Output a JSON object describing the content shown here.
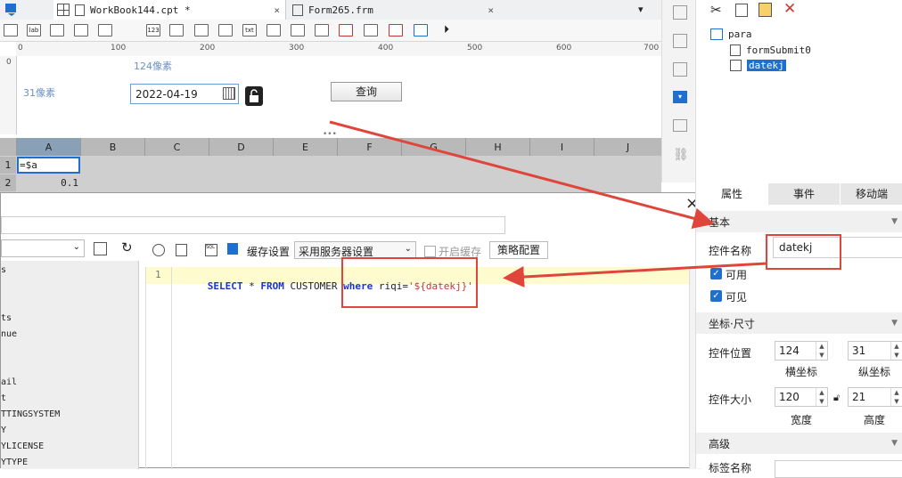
{
  "tabs": [
    {
      "label": "WorkBook144.cpt *",
      "close": "×"
    },
    {
      "label": "Form265.frm",
      "close": "×"
    }
  ],
  "ruler": {
    "marks": [
      "0",
      "100",
      "200",
      "300",
      "400",
      "500",
      "600",
      "700"
    ],
    "vmark": "0"
  },
  "form": {
    "x_label": "124像素",
    "y_label": "31像素",
    "date_value": "2022-04-19",
    "query_button": "查询"
  },
  "grid": {
    "columns": [
      "A",
      "B",
      "C",
      "D",
      "E",
      "F",
      "G",
      "H",
      "I",
      "J"
    ],
    "rows": [
      {
        "num": "1",
        "a": "=$a"
      },
      {
        "num": "2",
        "a": "0.1"
      }
    ]
  },
  "dialog": {
    "close": "×",
    "cache_label": "缓存设置",
    "cache_select": "采用服务器设置",
    "enable_cache": "开启缓存",
    "policy_button": "策略配置",
    "sql_line_no": "1",
    "sql": {
      "k1": "SELECT",
      "p1": " * ",
      "k2": "FROM",
      "p2": " CUSTOMER ",
      "k3": "where",
      "p3": " riqi=",
      "s1": "'${datekj}'"
    },
    "table_list": [
      "s",
      "",
      "",
      "ts",
      "nue",
      "",
      "",
      "ail",
      "t",
      "TTINGSYSTEM",
      "Y",
      "YLICENSE",
      "YTYPE"
    ]
  },
  "right": {
    "tree": [
      {
        "label": "para",
        "selected": false
      },
      {
        "label": "formSubmit0",
        "selected": false
      },
      {
        "label": "datekj",
        "selected": true
      }
    ],
    "tabs": [
      "属性",
      "事件",
      "移动端"
    ],
    "section_basic": "基本",
    "name_label": "控件名称",
    "name_value": "datekj",
    "visible_enabled": "可用",
    "visible_label": "可见",
    "section_pos": "坐标·尺寸",
    "pos_label": "控件位置",
    "pos_x": "124",
    "pos_y": "31",
    "x_caption": "横坐标",
    "y_caption": "纵坐标",
    "size_label": "控件大小",
    "size_w": "120",
    "size_h": "21",
    "w_caption": "宽度",
    "h_caption": "高度",
    "section_adv": "高级",
    "next_label": "标签名称"
  },
  "colors": {
    "accent": "#1f6fd1",
    "highlight": "#e0453b",
    "sql_bg": "#fefbcf"
  }
}
